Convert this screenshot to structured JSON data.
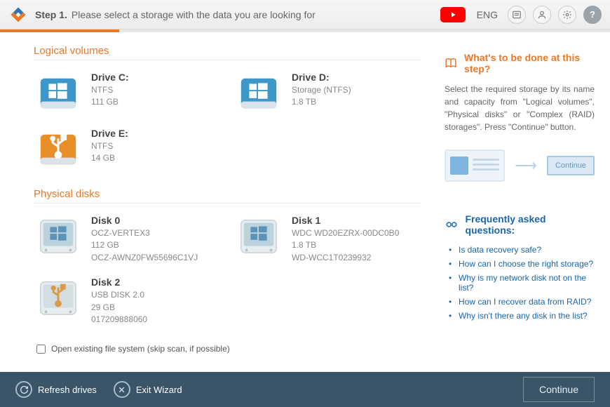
{
  "header": {
    "step_label": "Step 1.",
    "instruction": "Please select a storage with the data you are looking for",
    "lang": "ENG"
  },
  "sections": {
    "logical": "Logical volumes",
    "physical": "Physical disks"
  },
  "logical_volumes": [
    {
      "title": "Drive C:",
      "line1": "NTFS",
      "line2": "111 GB",
      "line3": "",
      "style": "blue-win"
    },
    {
      "title": "Drive D:",
      "line1": "Storage (NTFS)",
      "line2": "1.8 TB",
      "line3": "",
      "style": "blue-win"
    },
    {
      "title": "Drive E:",
      "line1": "NTFS",
      "line2": "14 GB",
      "line3": "",
      "style": "orange-usb"
    }
  ],
  "physical_disks": [
    {
      "title": "Disk 0",
      "line1": "OCZ-VERTEX3",
      "line2": "112 GB",
      "line3": "OCZ-AWNZ0FW55696C1VJ",
      "style": "gray-win"
    },
    {
      "title": "Disk 1",
      "line1": "WDC WD20EZRX-00DC0B0",
      "line2": "1.8 TB",
      "line3": "WD-WCC1T0239932",
      "style": "gray-win"
    },
    {
      "title": "Disk 2",
      "line1": "USB DISK 2.0",
      "line2": "29 GB",
      "line3": "017209888060",
      "style": "gray-usb"
    }
  ],
  "open_existing_label": "Open existing file system (skip scan, if possible)",
  "side": {
    "whats_title": "What's to be done at this step?",
    "whats_text": "Select the required storage by its name and capacity from \"Logical volumes\", \"Physical disks\" or \"Complex (RAID) storages\". Press \"Continue\" button.",
    "illu_continue": "Continue",
    "faq_title": "Frequently asked questions:",
    "faq": [
      "Is data recovery safe?",
      "How can I choose the right storage?",
      "Why is my network disk not on the list?",
      "How can I recover data from RAID?",
      "Why isn't there any disk in the list?"
    ]
  },
  "footer": {
    "refresh": "Refresh drives",
    "exit": "Exit Wizard",
    "continue": "Continue"
  }
}
